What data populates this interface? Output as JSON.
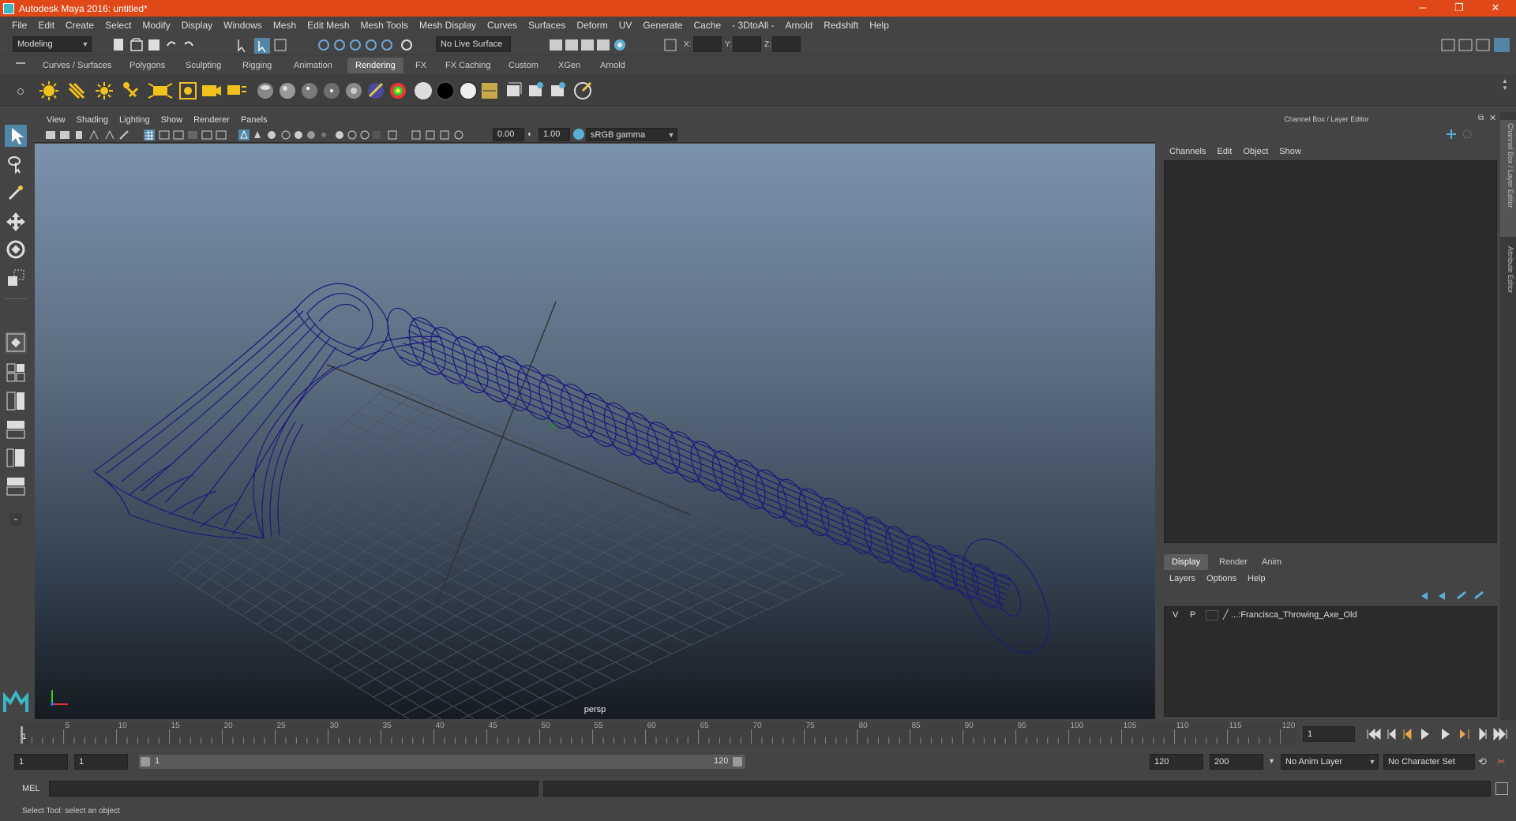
{
  "window": {
    "title": "Autodesk Maya 2016: untitled*",
    "minimize": "─",
    "maximize": "❐",
    "close": "✕"
  },
  "menubar": [
    "File",
    "Edit",
    "Create",
    "Select",
    "Modify",
    "Display",
    "Windows",
    "Mesh",
    "Edit Mesh",
    "Mesh Tools",
    "Mesh Display",
    "Curves",
    "Surfaces",
    "Deform",
    "UV",
    "Generate",
    "Cache",
    "- 3DtoAll -",
    "Arnold",
    "Redshift",
    "Help"
  ],
  "statusline": {
    "menuset": "Modeling",
    "live_surface": "No Live Surface",
    "x_label": "X:",
    "y_label": "Y:",
    "z_label": "Z:"
  },
  "shelf_tabs": [
    "Curves / Surfaces",
    "Polygons",
    "Sculpting",
    "Rigging",
    "Animation",
    "Rendering",
    "FX",
    "FX Caching",
    "Custom",
    "XGen",
    "Arnold"
  ],
  "active_shelf_tab": "Rendering",
  "viewport": {
    "menu": [
      "View",
      "Shading",
      "Lighting",
      "Show",
      "Renderer",
      "Panels"
    ],
    "exposure": "0.00",
    "gamma": "1.00",
    "color_space": "sRGB gamma",
    "camera": "persp"
  },
  "channel_box": {
    "header": "Channel Box / Layer Editor",
    "menu": [
      "Channels",
      "Edit",
      "Object",
      "Show"
    ]
  },
  "layer_editor": {
    "tabs": [
      "Display",
      "Render",
      "Anim"
    ],
    "active_tab": "Display",
    "menu": [
      "Layers",
      "Options",
      "Help"
    ],
    "layers": [
      {
        "v": "V",
        "p": "P",
        "name": "...:Francisca_Throwing_Axe_Old"
      }
    ]
  },
  "side_tabs": [
    "Channel Box / Layer Editor",
    "Attribute Editor"
  ],
  "timeline": {
    "ticks": [
      "5",
      "10",
      "15",
      "20",
      "25",
      "30",
      "35",
      "40",
      "45",
      "50",
      "55",
      "60",
      "65",
      "70",
      "75",
      "80",
      "85",
      "90",
      "95",
      "100",
      "105",
      "110",
      "115",
      "120"
    ],
    "current_marker": "1",
    "current_frame": "1"
  },
  "range": {
    "start": "1",
    "playback_start": "1",
    "slider_start": "1",
    "slider_end": "120",
    "playback_end": "120",
    "end": "200",
    "anim_layer": "No Anim Layer",
    "character_set": "No Character Set"
  },
  "cmdline": {
    "label": "MEL"
  },
  "helpline": "Select Tool: select an object",
  "colors": {
    "title_bar": "#e04818",
    "wireframe": "#1a1a78",
    "grid": "#4a5563"
  }
}
